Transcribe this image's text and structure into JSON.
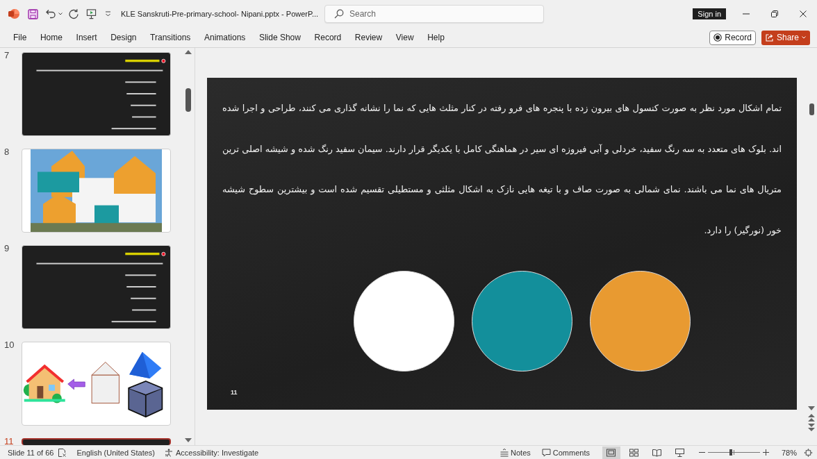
{
  "title_bar": {
    "document_title": "KLE Sanskruti-Pre-primary-school- Nipani.pptx - PowerP...",
    "search": {
      "placeholder": "Search"
    },
    "sign_in": "Sign in"
  },
  "ribbon": {
    "tabs": [
      "File",
      "Home",
      "Insert",
      "Design",
      "Transitions",
      "Animations",
      "Slide Show",
      "Record",
      "Review",
      "View",
      "Help"
    ],
    "record": "Record",
    "share": "Share"
  },
  "thumbnails": [
    {
      "number": "7",
      "kind": "text",
      "selected": false
    },
    {
      "number": "8",
      "kind": "photo",
      "selected": false
    },
    {
      "number": "9",
      "kind": "text",
      "selected": false
    },
    {
      "number": "10",
      "kind": "shapes",
      "selected": false
    },
    {
      "number": "11",
      "kind": "text",
      "selected": true
    }
  ],
  "slide": {
    "paragraph": "تمام اشکال مورد نظر به صورت کنسول های بیرون زده با پنجره های فرو رفته در کنار مثلث هایی که نما را نشانه گذاری می کنند، طراحی و اجرا شده اند. بلوک های متعدد به سه رنگ سفید، خردلی و آبی فیروزه ای سیر در هماهنگی کامل با یکدیگر قرار دارند. سیمان سفید رنگ شده و شیشه اصلی ترین متریال های نما می باشند. نمای شمالی به صورت صاف و با تیغه هایی نازک به اشکال مثلثی و مستطیلی تقسیم شده است و بیشترین سطوح شیشه خور (نورگیر) را دارد.",
    "circles": [
      {
        "color": "#ffffff"
      },
      {
        "color": "#138f9b"
      },
      {
        "color": "#e89a31"
      }
    ],
    "slide_number": "11"
  },
  "status_bar": {
    "slide_info": "Slide 11 of 66",
    "language": "English (United States)",
    "accessibility": "Accessibility: Investigate",
    "notes": "Notes",
    "comments": "Comments",
    "views": [
      {
        "kind": "normal",
        "selected": true
      },
      {
        "kind": "sorter",
        "selected": false
      },
      {
        "kind": "reading",
        "selected": false
      },
      {
        "kind": "slideshow",
        "selected": false
      }
    ],
    "zoom": {
      "level": 0.44,
      "reading": "78%"
    }
  }
}
